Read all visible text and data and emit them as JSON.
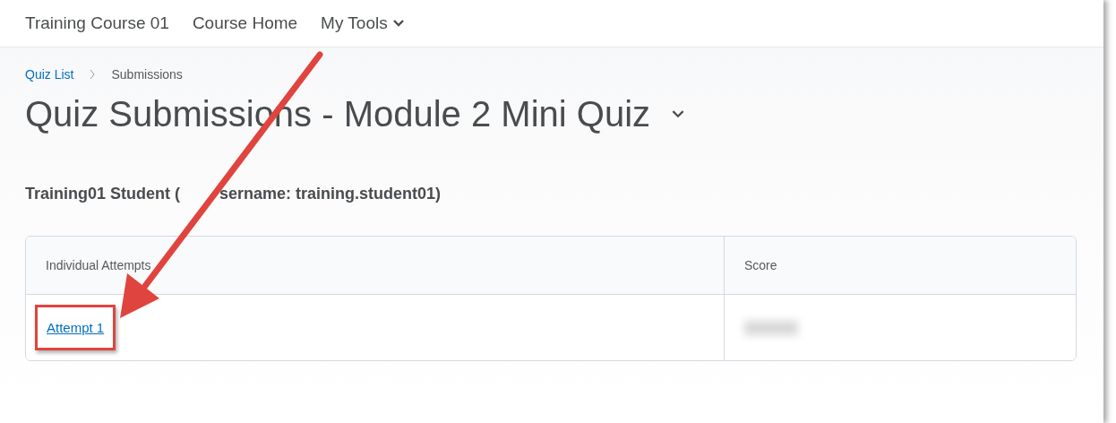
{
  "nav": {
    "items": [
      {
        "label": "Training Course 01",
        "kind": "link"
      },
      {
        "label": "Course Home",
        "kind": "link"
      },
      {
        "label": "My Tools",
        "kind": "menu"
      }
    ]
  },
  "breadcrumb": [
    "Quiz List",
    "Submissions"
  ],
  "title": "Quiz Submissions - Module 2 Mini Quiz",
  "student": [
    "Training01 Student (",
    "sername: training.student01)"
  ],
  "table": {
    "columns": [
      "Individual Attempts",
      "Score"
    ],
    "rows": [
      {
        "attempt": "Attempt 1",
        "highlighted": true
      }
    ]
  }
}
